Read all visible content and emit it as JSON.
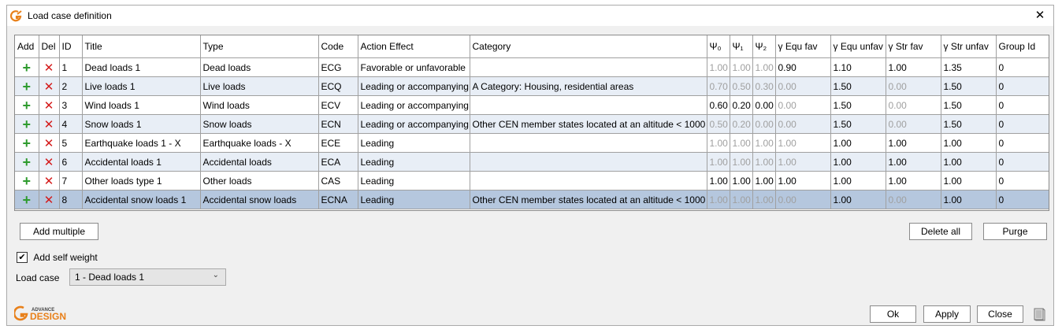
{
  "window": {
    "title": "Load case definition"
  },
  "columns": [
    "Add",
    "Del",
    "ID",
    "Title",
    "Type",
    "Code",
    "Action Effect",
    "Category",
    "Ψ₀",
    "Ψ₁",
    "Ψ₂",
    "γ Equ fav",
    "γ Equ unfav",
    "γ Str fav",
    "γ Str unfav",
    "Group Id"
  ],
  "rows": [
    {
      "id": "1",
      "title": "Dead loads 1",
      "type": "Dead loads",
      "code": "ECG",
      "action": "Favorable or unfavorable",
      "category": "",
      "psi0": "1.00",
      "psi1": "1.00",
      "psi2": "1.00",
      "equ_fav": "0.90",
      "equ_unfav": "1.10",
      "str_fav": "1.00",
      "str_unfav": "1.35",
      "group": "0"
    },
    {
      "id": "2",
      "title": "Live loads 1",
      "type": "Live loads",
      "code": "ECQ",
      "action": "Leading or accompanying",
      "category": "A Category: Housing, residential areas",
      "psi0": "0.70",
      "psi1": "0.50",
      "psi2": "0.30",
      "equ_fav": "0.00",
      "equ_unfav": "1.50",
      "str_fav": "0.00",
      "str_unfav": "1.50",
      "group": "0"
    },
    {
      "id": "3",
      "title": "Wind loads 1",
      "type": "Wind loads",
      "code": "ECV",
      "action": "Leading or accompanying",
      "category": "",
      "psi0": "0.60",
      "psi1": "0.20",
      "psi2": "0.00",
      "equ_fav": "0.00",
      "equ_unfav": "1.50",
      "str_fav": "0.00",
      "str_unfav": "1.50",
      "group": "0"
    },
    {
      "id": "4",
      "title": "Snow loads 1",
      "type": "Snow loads",
      "code": "ECN",
      "action": "Leading or accompanying",
      "category": "Other CEN member states located at an altitude < 1000",
      "psi0": "0.50",
      "psi1": "0.20",
      "psi2": "0.00",
      "equ_fav": "0.00",
      "equ_unfav": "1.50",
      "str_fav": "0.00",
      "str_unfav": "1.50",
      "group": "0"
    },
    {
      "id": "5",
      "title": "Earthquake loads 1 - X",
      "type": "Earthquake loads - X",
      "code": "ECE",
      "action": "Leading",
      "category": "",
      "psi0": "1.00",
      "psi1": "1.00",
      "psi2": "1.00",
      "equ_fav": "1.00",
      "equ_unfav": "1.00",
      "str_fav": "1.00",
      "str_unfav": "1.00",
      "group": "0"
    },
    {
      "id": "6",
      "title": "Accidental loads 1",
      "type": "Accidental loads",
      "code": "ECA",
      "action": "Leading",
      "category": "",
      "psi0": "1.00",
      "psi1": "1.00",
      "psi2": "1.00",
      "equ_fav": "1.00",
      "equ_unfav": "1.00",
      "str_fav": "1.00",
      "str_unfav": "1.00",
      "group": "0"
    },
    {
      "id": "7",
      "title": "Other loads type 1",
      "type": "Other loads",
      "code": "CAS",
      "action": "Leading",
      "category": "",
      "psi0": "1.00",
      "psi1": "1.00",
      "psi2": "1.00",
      "equ_fav": "1.00",
      "equ_unfav": "1.00",
      "str_fav": "1.00",
      "str_unfav": "1.00",
      "group": "0"
    },
    {
      "id": "8",
      "title": "Accidental snow loads 1",
      "type": "Accidental snow loads",
      "code": "ECNA",
      "action": "Leading",
      "category": "Other CEN member states located at an altitude < 1000",
      "psi0": "1.00",
      "psi1": "1.00",
      "psi2": "1.00",
      "equ_fav": "0.00",
      "equ_unfav": "1.00",
      "str_fav": "0.00",
      "str_unfav": "1.00",
      "group": "0"
    }
  ],
  "buttons": {
    "add_multiple": "Add multiple",
    "delete_all": "Delete all",
    "purge": "Purge",
    "ok": "Ok",
    "apply": "Apply",
    "close": "Close"
  },
  "self_weight": {
    "label": "Add self weight",
    "checked": true
  },
  "load_case": {
    "label": "Load case",
    "value": "1 - Dead loads 1"
  },
  "logo": {
    "line1": "ADVANCE",
    "line2": "DESIGN"
  },
  "colors": {
    "plus": "#2e9b2e",
    "delete": "#d41a1a",
    "selected_row": "#b5c7de",
    "alt_row": "#e8eef6",
    "brand": "#e8801a"
  }
}
